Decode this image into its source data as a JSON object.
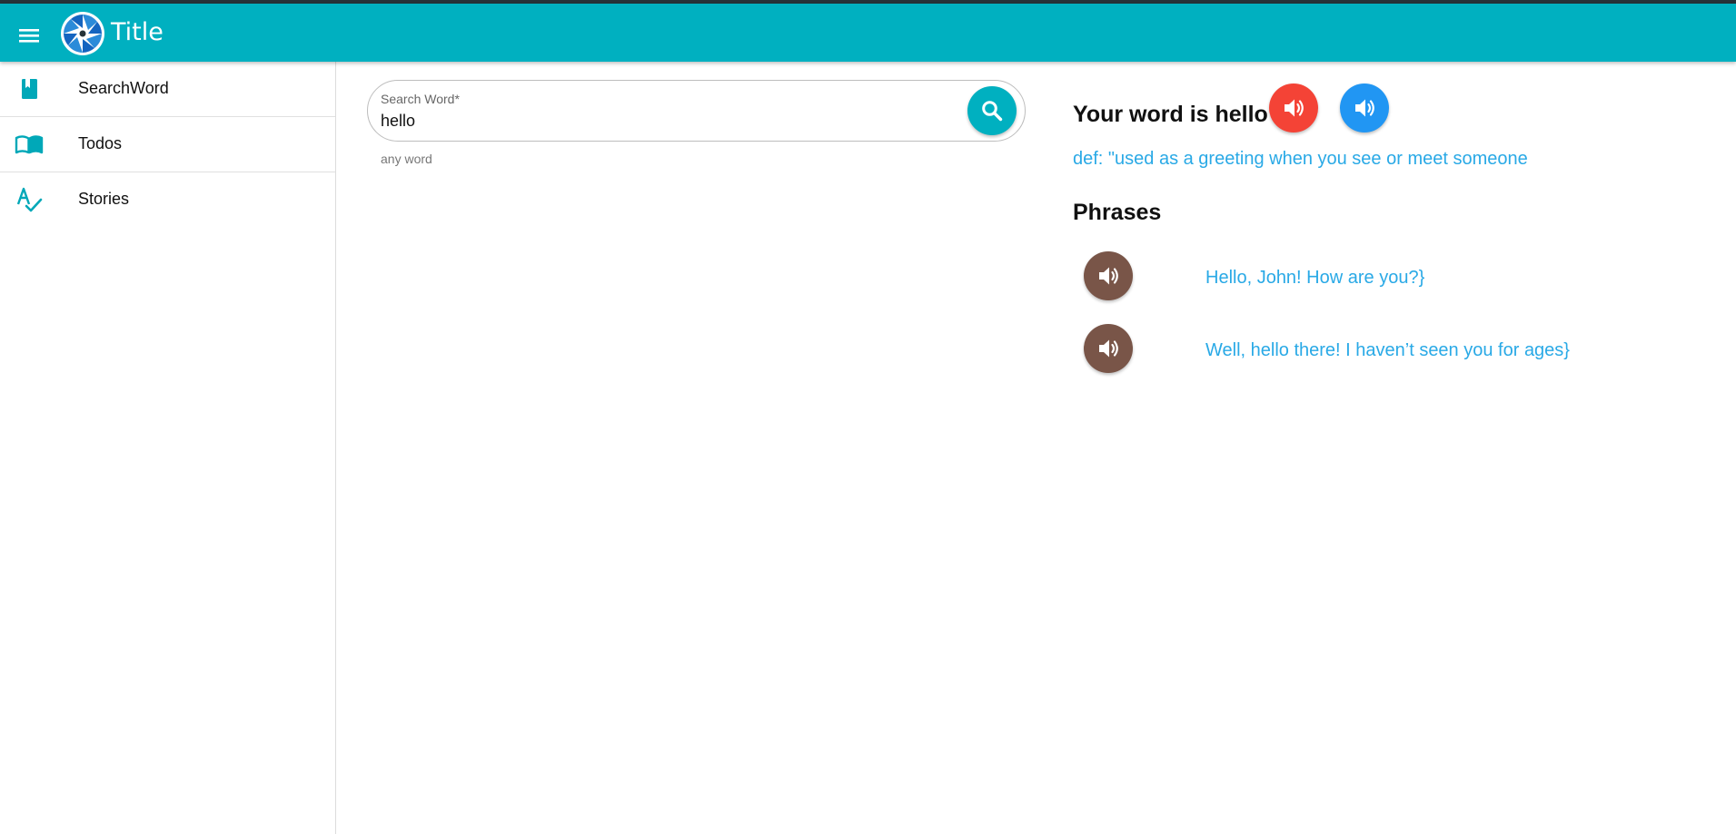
{
  "header": {
    "menu_icon": "hamburger-menu-icon",
    "logo_icon": "aperture-logo-icon",
    "title": "Title",
    "color": "#00b0c0"
  },
  "sidebar": {
    "items": [
      {
        "label": "SearchWord",
        "icon": "bookmark-book-icon"
      },
      {
        "label": "Todos",
        "icon": "open-book-icon"
      },
      {
        "label": "Stories",
        "icon": "spellcheck-icon"
      }
    ]
  },
  "search": {
    "label": "Search Word*",
    "value": "hello",
    "hint": "any word",
    "button_icon": "search-icon"
  },
  "result": {
    "heading": "Your word is hello",
    "definition": "def: \"used as a greeting when you see or meet someone",
    "speak_buttons": [
      {
        "icon": "volume-icon",
        "color": "#f44336"
      },
      {
        "icon": "volume-icon",
        "color": "#2196f3"
      }
    ]
  },
  "phrases": {
    "heading": "Phrases",
    "items": [
      {
        "text": "Hello, John! How are you?}",
        "icon": "volume-icon",
        "color": "#795548"
      },
      {
        "text": "Well, hello there! I haven’t seen you for ages}",
        "icon": "volume-icon",
        "color": "#795548"
      }
    ]
  },
  "colors": {
    "accent": "#00b0c0",
    "link": "#29a9e6"
  }
}
